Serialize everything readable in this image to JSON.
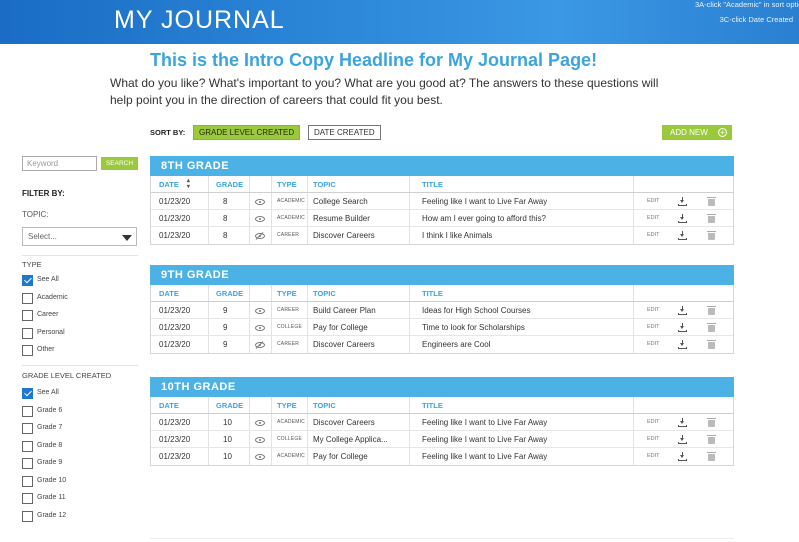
{
  "header": {
    "title": "MY JOURNAL",
    "notes": [
      "3A-click \"Academic\" in sort options",
      "3C-click Date Created"
    ]
  },
  "headline": "This is the Intro Copy Headline for My Journal Page!",
  "intro": "What do you like? What's important to you? What are you good at? The answers to these questions will help point you in the direction of careers that could fit you best.",
  "sort": {
    "label": "SORT BY:",
    "options": [
      "GRADE LEVEL CREATED",
      "DATE CREATED"
    ],
    "selected": "GRADE LEVEL CREATED"
  },
  "add_new_label": "ADD NEW",
  "sidebar": {
    "keyword_placeholder": "Keyword",
    "search_label": "SEARCH",
    "filter_by": "FILTER BY:",
    "topic_label": "TOPIC:",
    "topic_select": "Select...",
    "type_label": "TYPE",
    "type_options": [
      {
        "label": "See All",
        "checked": true
      },
      {
        "label": "Academic",
        "checked": false
      },
      {
        "label": "Career",
        "checked": false
      },
      {
        "label": "Personal",
        "checked": false
      },
      {
        "label": "Other",
        "checked": false
      }
    ],
    "grade_label": "GRADE LEVEL CREATED",
    "grade_options": [
      {
        "label": "See All",
        "checked": true
      },
      {
        "label": "Grade 6",
        "checked": false
      },
      {
        "label": "Grade 7",
        "checked": false
      },
      {
        "label": "Grade 8",
        "checked": false
      },
      {
        "label": "Grade 9",
        "checked": false
      },
      {
        "label": "Grade 10",
        "checked": false
      },
      {
        "label": "Grade 11",
        "checked": false
      },
      {
        "label": "Grade 12",
        "checked": false
      }
    ]
  },
  "columns": {
    "date": "DATE",
    "grade": "GRADE",
    "type": "TYPE",
    "topic": "TOPIC",
    "title": "TITLE"
  },
  "edit_label": "EDIT",
  "groups": [
    {
      "name": "8TH GRADE",
      "rows": [
        {
          "date": "01/23/20",
          "grade": "8",
          "visible": true,
          "type": "ACADEMIC",
          "topic": "College Search",
          "title": "Feeling like I want to Live Far Away"
        },
        {
          "date": "01/23/20",
          "grade": "8",
          "visible": true,
          "type": "ACADEMIC",
          "topic": "Resume Builder",
          "title": "How am I ever going to afford this?"
        },
        {
          "date": "01/23/20",
          "grade": "8",
          "visible": false,
          "type": "CAREER",
          "topic": "Discover Careers",
          "title": "I think I like Animals"
        }
      ]
    },
    {
      "name": "9TH GRADE",
      "rows": [
        {
          "date": "01/23/20",
          "grade": "9",
          "visible": true,
          "type": "CAREER",
          "topic": "Build Career Plan",
          "title": "Ideas for High School Courses"
        },
        {
          "date": "01/23/20",
          "grade": "9",
          "visible": true,
          "type": "COLLEGE",
          "topic": "Pay for College",
          "title": "Time to look for Scholarships"
        },
        {
          "date": "01/23/20",
          "grade": "9",
          "visible": false,
          "type": "CAREER",
          "topic": "Discover Careers",
          "title": "Engineers are Cool"
        }
      ]
    },
    {
      "name": "10TH GRADE",
      "rows": [
        {
          "date": "01/23/20",
          "grade": "10",
          "visible": true,
          "type": "ACADEMIC",
          "topic": "Discover Careers",
          "title": "Feeling like I want to Live Far Away"
        },
        {
          "date": "01/23/20",
          "grade": "10",
          "visible": true,
          "type": "COLLEGE",
          "topic": "My College Applica...",
          "title": "Feeling like I want to Live Far Away"
        },
        {
          "date": "01/23/20",
          "grade": "10",
          "visible": true,
          "type": "ACADEMIC",
          "topic": "Pay for College",
          "title": "Feeling like I want to Live Far Away"
        }
      ]
    }
  ]
}
